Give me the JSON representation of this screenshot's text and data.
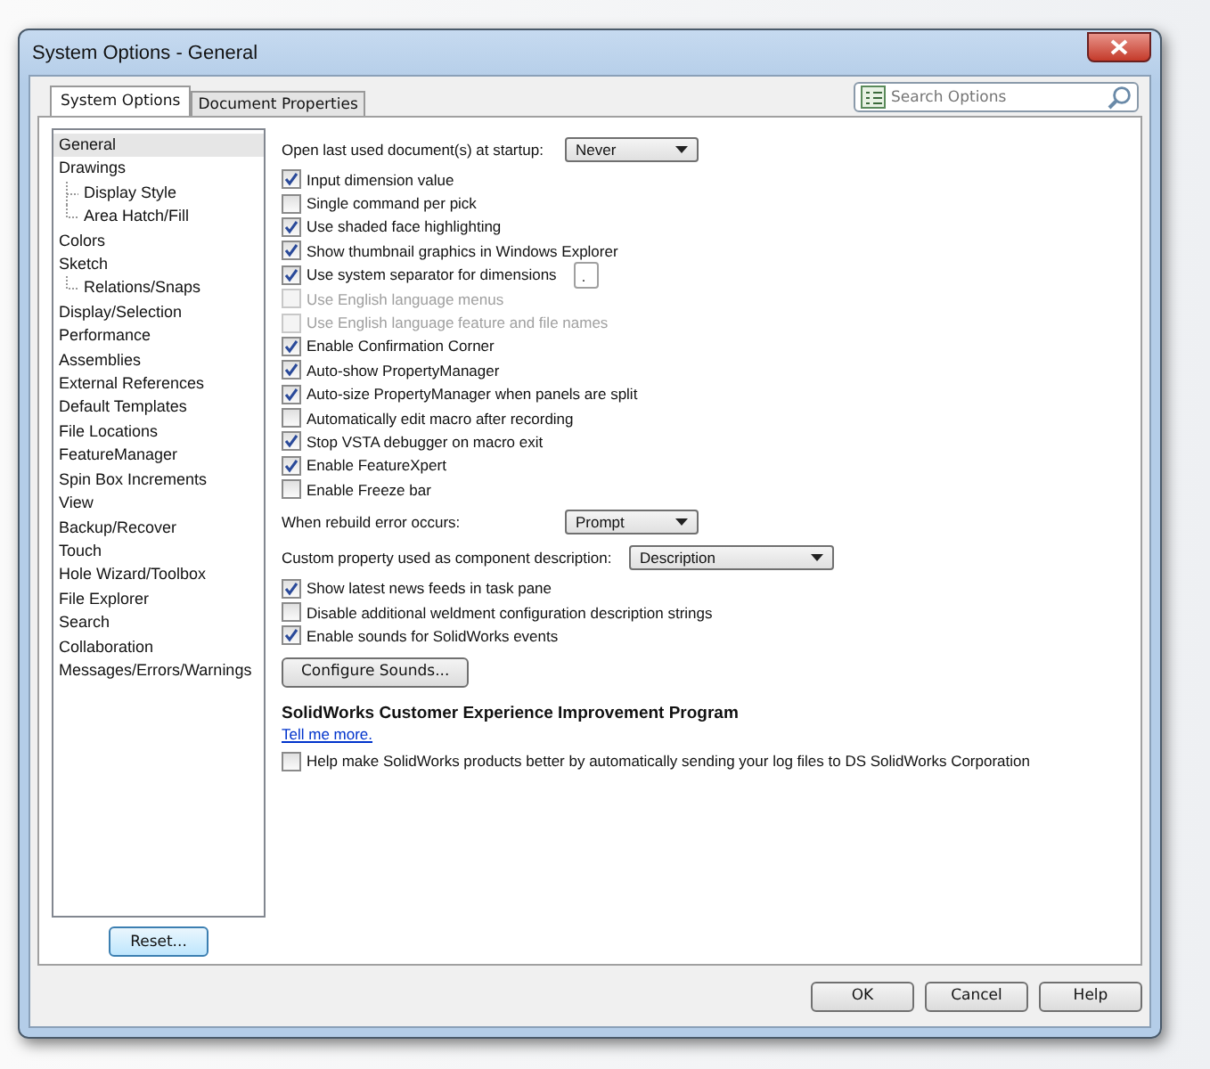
{
  "window": {
    "title": "System Options - General"
  },
  "tabs": [
    {
      "label": "System Options",
      "selected": true
    },
    {
      "label": "Document Properties",
      "selected": false
    }
  ],
  "search": {
    "placeholder": "Search Options"
  },
  "tree": [
    {
      "label": "General",
      "selected": true
    },
    {
      "label": "Drawings",
      "selected": false,
      "children": [
        {
          "label": "Display Style",
          "selected": false
        },
        {
          "label": "Area Hatch/Fill",
          "selected": false
        }
      ]
    },
    {
      "label": "Colors",
      "selected": false
    },
    {
      "label": "Sketch",
      "selected": false,
      "children": [
        {
          "label": "Relations/Snaps",
          "selected": false
        }
      ]
    },
    {
      "label": "Display/Selection",
      "selected": false
    },
    {
      "label": "Performance",
      "selected": false
    },
    {
      "label": "Assemblies",
      "selected": false
    },
    {
      "label": "External References",
      "selected": false
    },
    {
      "label": "Default Templates",
      "selected": false
    },
    {
      "label": "File Locations",
      "selected": false
    },
    {
      "label": "FeatureManager",
      "selected": false
    },
    {
      "label": "Spin Box Increments",
      "selected": false
    },
    {
      "label": "View",
      "selected": false
    },
    {
      "label": "Backup/Recover",
      "selected": false
    },
    {
      "label": "Touch",
      "selected": false
    },
    {
      "label": "Hole Wizard/Toolbox",
      "selected": false
    },
    {
      "label": "File Explorer",
      "selected": false
    },
    {
      "label": "Search",
      "selected": false
    },
    {
      "label": "Collaboration",
      "selected": false
    },
    {
      "label": "Messages/Errors/Warnings",
      "selected": false
    }
  ],
  "reset_button": "Reset...",
  "options": [
    {
      "kind": "dropdown",
      "label": "Open last used document(s) at startup:",
      "value": "Never",
      "wide": false
    },
    {
      "kind": "checkbox",
      "label": "Input dimension value",
      "checked": true,
      "disabled": false
    },
    {
      "kind": "checkbox",
      "label": "Single command per pick",
      "checked": false,
      "disabled": false
    },
    {
      "kind": "checkbox",
      "label": "Use shaded face highlighting",
      "checked": true,
      "disabled": false
    },
    {
      "kind": "checkbox",
      "label": "Show thumbnail graphics in Windows Explorer",
      "checked": true,
      "disabled": false
    },
    {
      "kind": "checkbox",
      "label": "Use system separator for dimensions",
      "checked": true,
      "disabled": false,
      "field": "."
    },
    {
      "kind": "checkbox",
      "label": "Use English language menus",
      "checked": false,
      "disabled": true
    },
    {
      "kind": "checkbox",
      "label": "Use English language feature and file names",
      "checked": false,
      "disabled": true
    },
    {
      "kind": "checkbox",
      "label": "Enable Confirmation Corner",
      "checked": true,
      "disabled": false
    },
    {
      "kind": "checkbox",
      "label": "Auto-show PropertyManager",
      "checked": true,
      "disabled": false
    },
    {
      "kind": "checkbox",
      "label": "Auto-size PropertyManager when panels are split",
      "checked": true,
      "disabled": false
    },
    {
      "kind": "checkbox",
      "label": "Automatically edit macro after recording",
      "checked": false,
      "disabled": false
    },
    {
      "kind": "checkbox",
      "label": "Stop VSTA debugger on macro exit",
      "checked": true,
      "disabled": false
    },
    {
      "kind": "checkbox",
      "label": "Enable FeatureXpert",
      "checked": true,
      "disabled": false
    },
    {
      "kind": "checkbox",
      "label": "Enable Freeze bar",
      "checked": false,
      "disabled": false
    },
    {
      "kind": "dropdown",
      "label": "When rebuild error occurs:",
      "value": "Prompt",
      "wide": false
    },
    {
      "kind": "dropdown",
      "label": "Custom property used as component description:",
      "value": "Description",
      "wide": true
    },
    {
      "kind": "checkbox",
      "label": "Show latest news feeds in task pane",
      "checked": true,
      "disabled": false
    },
    {
      "kind": "checkbox",
      "label": "Disable additional weldment configuration description strings",
      "checked": false,
      "disabled": false
    },
    {
      "kind": "checkbox",
      "label": "Enable sounds for SolidWorks events",
      "checked": true,
      "disabled": false
    },
    {
      "kind": "button",
      "label": "Configure Sounds..."
    },
    {
      "kind": "heading",
      "label": "SolidWorks Customer Experience Improvement Program"
    },
    {
      "kind": "link",
      "label": "Tell me more."
    },
    {
      "kind": "checkbox",
      "label": "Help make SolidWorks products better by automatically sending your log files to DS SolidWorks Corporation",
      "checked": false,
      "disabled": false
    }
  ],
  "buttons": [
    "OK",
    "Cancel",
    "Help"
  ]
}
